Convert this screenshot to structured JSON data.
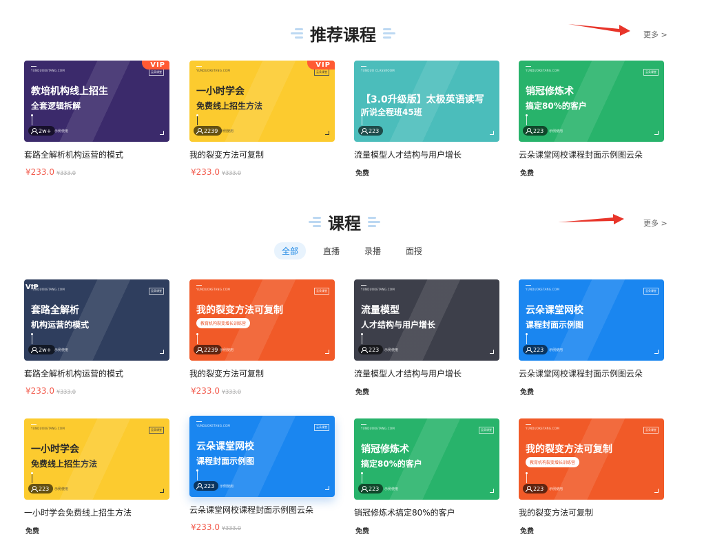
{
  "recommended": {
    "title": "推荐课程",
    "more": "更多 >",
    "cards": [
      {
        "brand": "YUNDUOKETANG.COM",
        "vip": "VIP",
        "tag": "云朵课堂",
        "line1": "教培机构线上招生",
        "line2": "全套逻辑拆解",
        "count": "2w+",
        "free_use": "示例使用",
        "title": "套路全解析机构运营的模式",
        "price": "¥233.0",
        "orig": "¥333.0",
        "bg": "#3b2a6b"
      },
      {
        "brand": "YUNDUOKETANG.COM",
        "vip": "VIP",
        "tag": "云朵课堂",
        "line1": "一小时学会",
        "line2": "免费线上招生方法",
        "count": "2239",
        "free_use": "示例使用",
        "title": "我的裂变方法可复制",
        "price": "¥233.0",
        "orig": "¥333.0",
        "bg": "#fccb2f"
      },
      {
        "brand": "YUNDUO CLASSROOM",
        "line1": "【3.0升级版】太极英语读写",
        "line2": "听说全程班45班",
        "count": "223",
        "free_use": "",
        "title": "流量模型人才结构与用户增长",
        "free": "免费",
        "bg": "#4bbdbb"
      },
      {
        "brand": "YUNDUOKETANG.COM",
        "tag": "云朵课堂",
        "line1": "销冠修炼术",
        "line2": "搞定80%的客户",
        "count": "223",
        "free_use": "示例使用",
        "title": "云朵课堂网校课程封面示例图云朵",
        "free": "免费",
        "bg": "#28b36b"
      }
    ]
  },
  "courses": {
    "title": "课程",
    "more": "更多 >",
    "tabs": [
      "全部",
      "直播",
      "录播",
      "面授"
    ],
    "cards": [
      {
        "brand": "YUNDUOKETANG.COM",
        "vip_plain": "VIP",
        "tag": "云朵课堂",
        "line1": "套路全解析",
        "line2": "机构运营的模式",
        "count": "2w+",
        "free_use": "示例使用",
        "title": "套路全解析机构运营的模式",
        "price": "¥233.0",
        "orig": "¥333.0",
        "bg": "#2f3e5e"
      },
      {
        "brand": "YUNDUOKETANG.COM",
        "tag": "云朵课堂",
        "line1": "我的裂变方法可复制",
        "pill": "教育机构裂变增长训练营",
        "count": "2239",
        "free_use": "示例使用",
        "title": "我的裂变方法可复制",
        "price": "¥233.0",
        "orig": "¥333.0",
        "bg": "#f15a28"
      },
      {
        "brand": "YUNDUOKETANG.COM",
        "tag": "",
        "line1": "流量模型",
        "line2": "人才结构与用户增长",
        "count": "223",
        "free_use": "示例使用",
        "title": "流量模型人才结构与用户增长",
        "free": "免费",
        "bg": "#3d3f4a"
      },
      {
        "brand": "YUNDUOKETANG.COM",
        "tag": "云朵课堂",
        "line1": "云朵课堂网校",
        "line2": "课程封面示例图",
        "count": "223",
        "free_use": "示例使用",
        "title": "云朵课堂网校课程封面示例图云朵",
        "free": "免费",
        "bg": "#1a86f0"
      },
      {
        "brand": "YUNDUOKETANG.COM",
        "tag": "云朵课堂",
        "line1": "一小时学会",
        "line2": "免费线上招生方法",
        "count": "223",
        "free_use": "示例使用",
        "title": "一小时学会免费线上招生方法",
        "free": "免费",
        "bg": "#fccb2f"
      },
      {
        "brand": "YUNDUOKETANG.COM",
        "tag": "云朵课堂",
        "line1": "云朵课堂网校",
        "line2": "课程封面示例图",
        "count": "223",
        "free_use": "示例使用",
        "title": "云朵课堂网校课程封面示例图云朵",
        "price": "¥233.0",
        "orig": "¥333.0",
        "bg": "#1a86f0"
      },
      {
        "brand": "YUNDUOKETANG.COM",
        "tag": "云朵课堂",
        "line1": "销冠修炼术",
        "line2": "搞定80%的客户",
        "count": "223",
        "free_use": "示例使用",
        "title": "销冠修炼术搞定80%的客户",
        "free": "免费",
        "bg": "#28b36b"
      },
      {
        "brand": "YUNDUOKETANG.COM",
        "tag": "云朵课堂",
        "line1": "我的裂变方法可复制",
        "pill": "教育机构裂变增长训练营",
        "count": "223",
        "free_use": "示例使用",
        "title": "我的裂变方法可复制",
        "free": "免费",
        "bg": "#f15a28"
      }
    ]
  },
  "icons": {
    "user": "user-icon",
    "arrow": "red-arrow-icon"
  },
  "colors": {
    "accent": "#1e88e5",
    "price": "#f25a4c",
    "vip": "#ff5a33"
  }
}
